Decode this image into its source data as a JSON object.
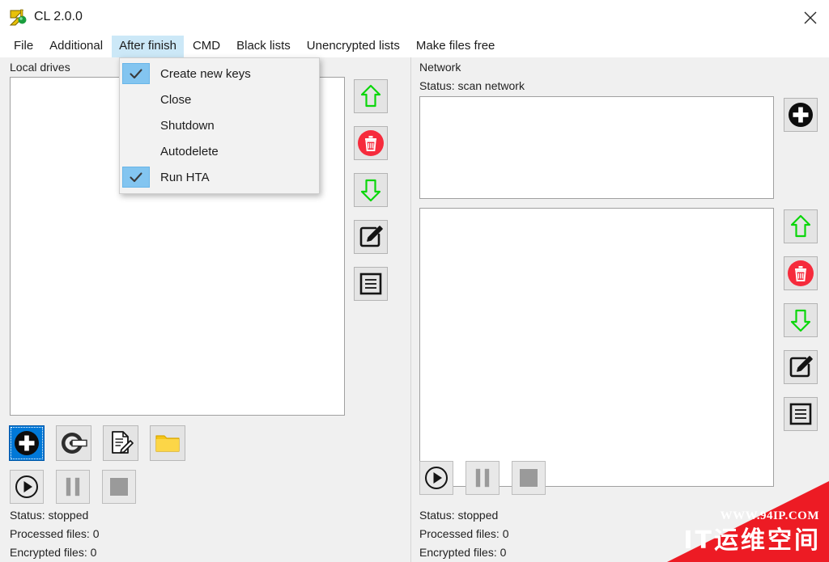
{
  "window": {
    "title": "CL 2.0.0",
    "app_icon": "archive-icon",
    "close_label": "✕"
  },
  "menubar": {
    "items": [
      {
        "label": "File",
        "open": false
      },
      {
        "label": "Additional",
        "open": false
      },
      {
        "label": "After finish",
        "open": true
      },
      {
        "label": "CMD",
        "open": false
      },
      {
        "label": "Black lists",
        "open": false
      },
      {
        "label": "Unencrypted lists",
        "open": false
      },
      {
        "label": "Make files free",
        "open": false
      }
    ]
  },
  "dropdown": {
    "owner": "After finish",
    "items": [
      {
        "label": "Create new keys",
        "checked": true
      },
      {
        "label": "Close",
        "checked": false
      },
      {
        "label": "Shutdown",
        "checked": false
      },
      {
        "label": "Autodelete",
        "checked": false
      },
      {
        "label": "Run HTA",
        "checked": true
      }
    ]
  },
  "left_panel": {
    "label": "Local drives",
    "list_items": [],
    "toolbar": [
      {
        "icon": "up-arrow-icon",
        "name": "move-up-button"
      },
      {
        "icon": "trash-icon",
        "name": "delete-button"
      },
      {
        "icon": "down-arrow-icon",
        "name": "move-down-button"
      },
      {
        "icon": "edit-pencil-icon",
        "name": "edit-button"
      },
      {
        "icon": "list-lines-icon",
        "name": "list-button"
      }
    ],
    "source_buttons": [
      {
        "icon": "plus-circle-icon",
        "name": "add-drive-button",
        "selected": true
      },
      {
        "icon": "disc-drive-icon",
        "name": "add-disc-button",
        "selected": false
      },
      {
        "icon": "document-edit-icon",
        "name": "add-document-button",
        "selected": false
      },
      {
        "icon": "folder-icon",
        "name": "add-folder-button",
        "selected": false
      }
    ],
    "transport": [
      {
        "icon": "play-icon",
        "name": "start-button"
      },
      {
        "icon": "pause-icon",
        "name": "pause-button"
      },
      {
        "icon": "stop-icon",
        "name": "stop-button"
      }
    ],
    "status": "Status: stopped",
    "processed_files": "Processed files: 0",
    "encrypted_files": "Encrypted files: 0"
  },
  "right_panel": {
    "label": "Network",
    "status_top": "Status: scan network",
    "list_items_top": [],
    "list_items_bottom": [],
    "add_button": {
      "icon": "plus-circle-icon",
      "name": "add-network-button"
    },
    "toolbar": [
      {
        "icon": "up-arrow-icon",
        "name": "move-up-button"
      },
      {
        "icon": "trash-icon",
        "name": "delete-button"
      },
      {
        "icon": "down-arrow-icon",
        "name": "move-down-button"
      },
      {
        "icon": "edit-pencil-icon",
        "name": "edit-button"
      },
      {
        "icon": "list-lines-icon",
        "name": "list-button"
      }
    ],
    "transport": [
      {
        "icon": "play-icon",
        "name": "start-button"
      },
      {
        "icon": "pause-icon",
        "name": "pause-button"
      },
      {
        "icon": "stop-icon",
        "name": "stop-button"
      }
    ],
    "status": "Status: stopped",
    "processed_files": "Processed files: 0",
    "encrypted_files": "Encrypted files: 0"
  },
  "watermark": {
    "url": "WWW.94IP.COM",
    "text": "IT运维空间",
    "color": "#ed1b24"
  },
  "colors": {
    "menu_highlight": "#cce8f7",
    "check_highlight": "#83c5f0",
    "selection": "#0078d7",
    "arrow_green": "#00d000",
    "trash_red": "#f62b3c",
    "folder_yellow": "#f5c518",
    "window_bg": "#f0f0f0"
  }
}
